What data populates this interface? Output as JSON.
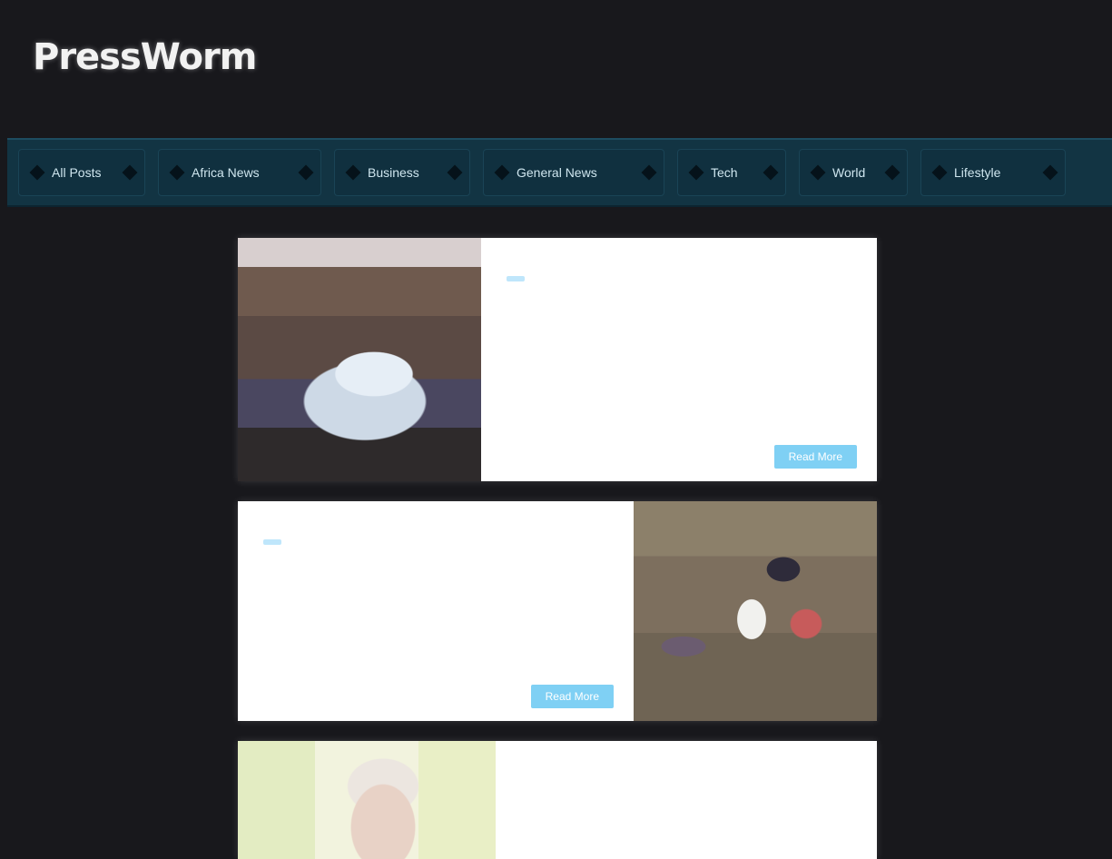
{
  "site": {
    "logo_text": "PressWorm"
  },
  "nav": {
    "items": [
      {
        "label": "All Posts",
        "width": 140
      },
      {
        "label": "Africa News",
        "width": 180
      },
      {
        "label": "Business",
        "width": 150
      },
      {
        "label": "General News",
        "width": 200
      },
      {
        "label": "Tech",
        "width": 120
      },
      {
        "label": "World",
        "width": 120
      },
      {
        "label": "Lifestyle",
        "width": 160
      }
    ]
  },
  "posts": [
    {
      "headline": "",
      "meta": "",
      "tag": "",
      "excerpt": "",
      "read_more": "Read More",
      "image_icon": "motorcade-photo"
    },
    {
      "headline": "",
      "meta": "",
      "tag": "",
      "excerpt": "",
      "read_more": "Read More",
      "image_icon": "field-photo"
    },
    {
      "headline": "",
      "meta": "",
      "image_icon": "portrait-photo"
    }
  ],
  "colors": {
    "background": "#18181c",
    "navbar": "#123443",
    "tag_bg": "#bfe6fb",
    "button_bg": "#7fd0f4"
  }
}
